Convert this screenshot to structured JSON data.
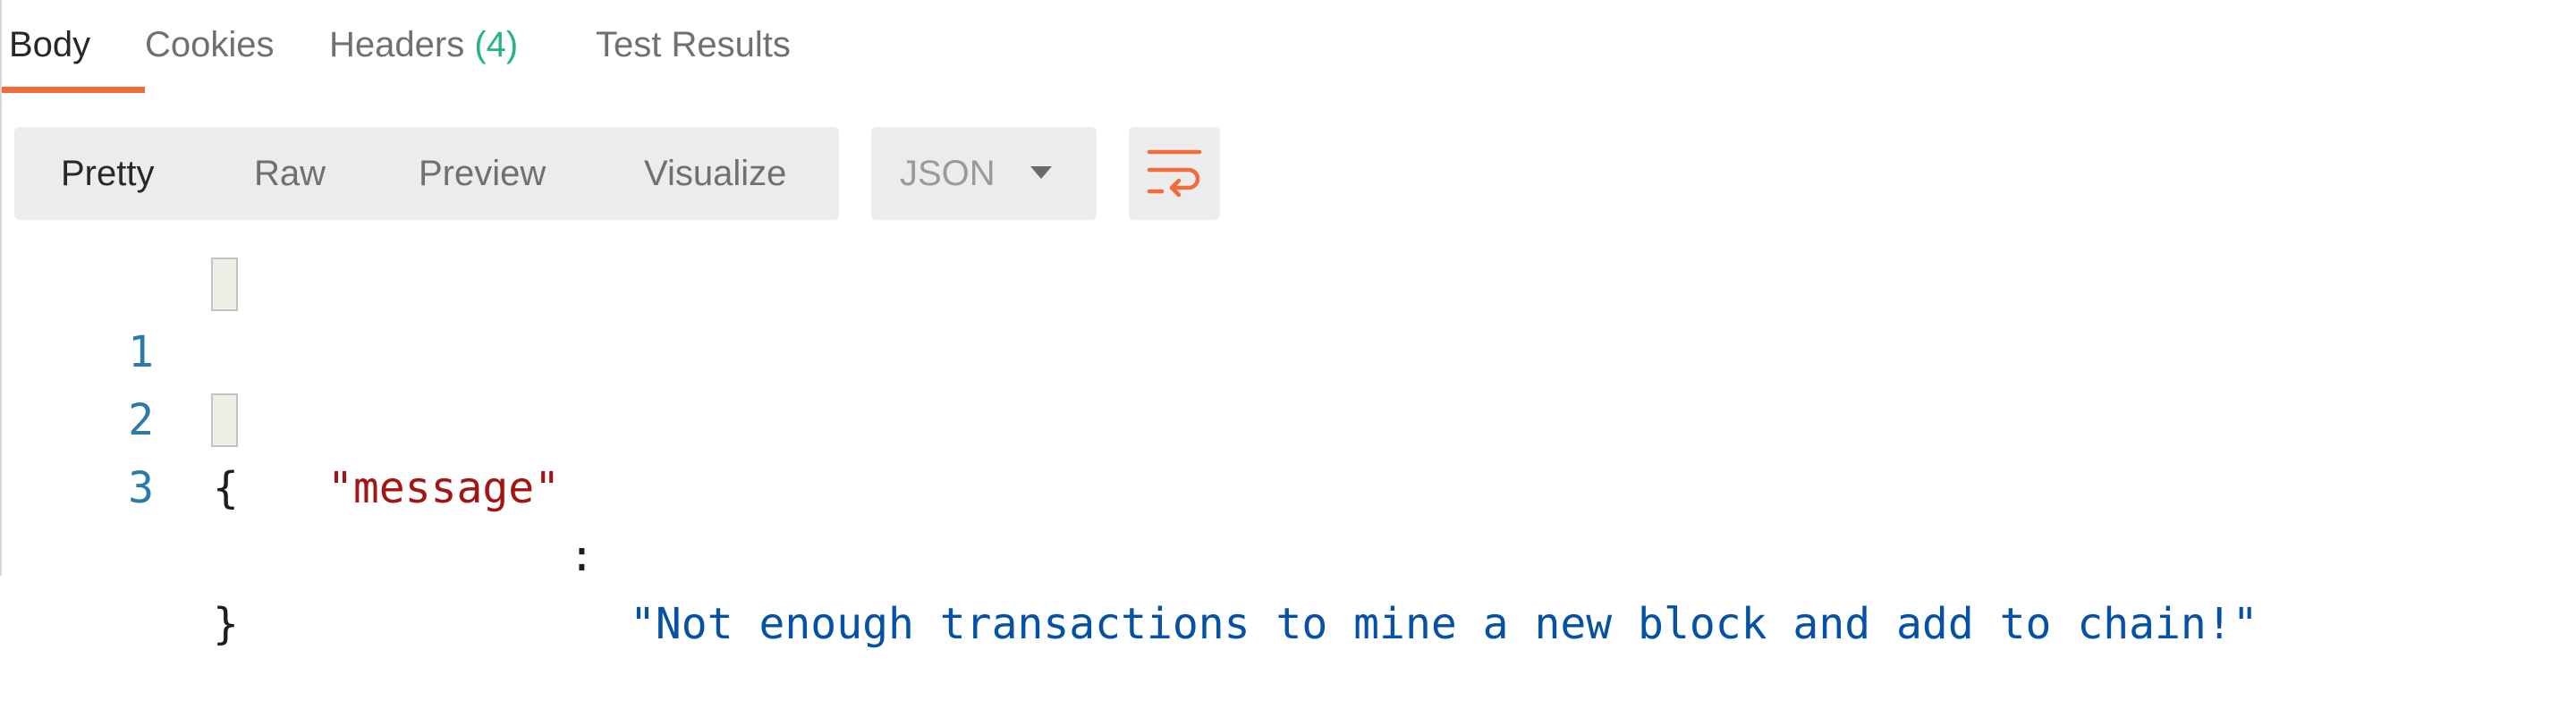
{
  "tabs": [
    {
      "label": "Body",
      "active": true
    },
    {
      "label": "Cookies",
      "active": false
    },
    {
      "label": "Headers",
      "count": "(4)",
      "active": false
    },
    {
      "label": "Test Results",
      "active": false
    }
  ],
  "toolbar": {
    "view_modes": [
      "Pretty",
      "Raw",
      "Preview",
      "Visualize"
    ],
    "active_view": "Pretty",
    "format": {
      "selected": "JSON",
      "icon": "chevron-down-icon"
    },
    "wrap_button": {
      "icon": "text-wrap-icon"
    }
  },
  "response": {
    "line_numbers": [
      "1",
      "2",
      "3"
    ],
    "open_brace": "{",
    "key": "\"message\"",
    "colon": ":",
    "value": "\"Not enough transactions to mine a new block and add to chain!\"",
    "close_brace": "}"
  },
  "colors": {
    "accent": "#f26b3a",
    "count": "#26b47f",
    "json_key": "#a31515",
    "json_string": "#0451a5",
    "line_number": "#2a7ba6"
  }
}
